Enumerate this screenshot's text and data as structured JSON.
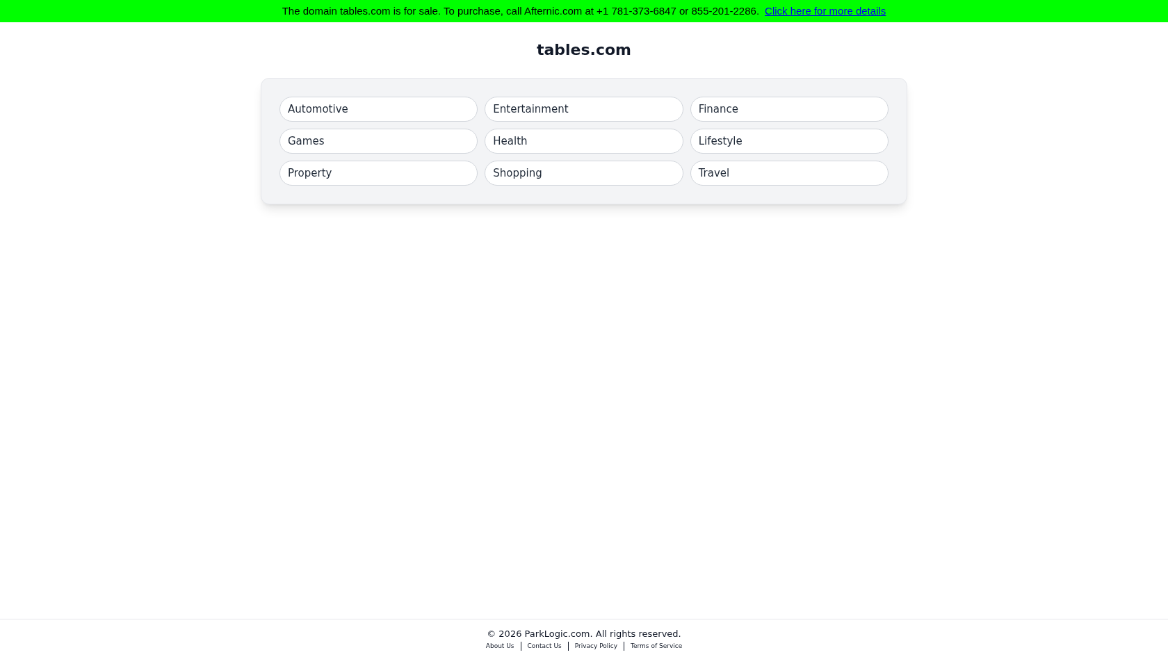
{
  "banner": {
    "text": "The domain tables.com is for sale. To purchase, call Afternic.com at +1 781-373-6847 or 855-201-2286.",
    "link": "Click here for more details"
  },
  "title": "tables.com",
  "categories": [
    "Automotive",
    "Entertainment",
    "Finance",
    "Games",
    "Health",
    "Lifestyle",
    "Property",
    "Shopping",
    "Travel"
  ],
  "footer": {
    "copyright": "© 2026 ParkLogic.com. All rights reserved.",
    "links": [
      "About Us",
      "Contact Us",
      "Privacy Policy",
      "Terms of Service"
    ]
  }
}
